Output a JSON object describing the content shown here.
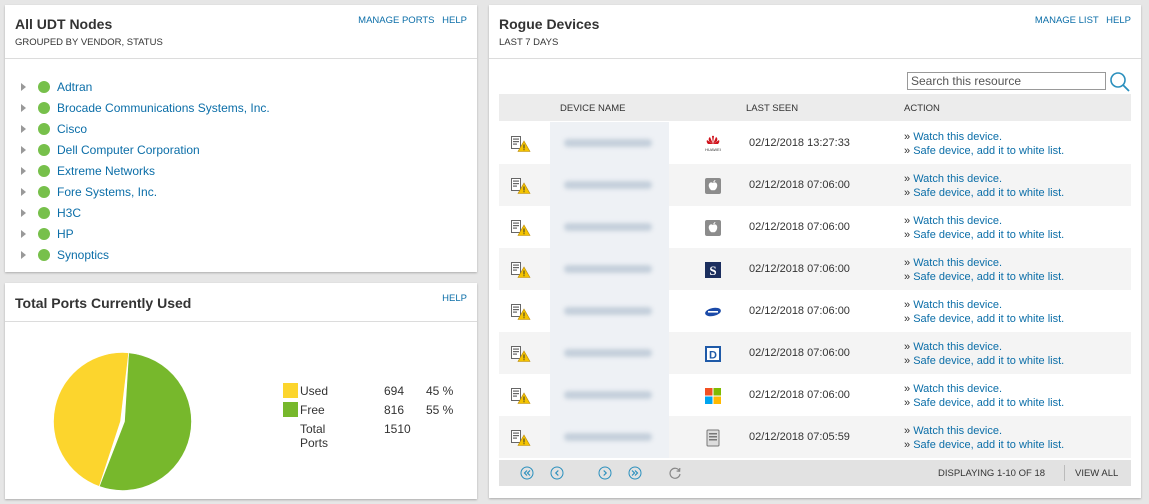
{
  "udt": {
    "title": "All UDT Nodes",
    "subtitle": "GROUPED BY VENDOR, STATUS",
    "links": {
      "manage": "MANAGE PORTS",
      "help": "HELP"
    },
    "vendors": [
      "Adtran",
      "Brocade Communications Systems, Inc.",
      "Cisco",
      "Dell Computer Corporation",
      "Extreme Networks",
      "Fore Systems, Inc.",
      "H3C",
      "HP",
      "Synoptics"
    ],
    "status_color": "#77c04b"
  },
  "ports": {
    "title": "Total Ports Currently Used",
    "links": {
      "help": "HELP"
    },
    "legend": [
      {
        "label": "Used",
        "value": "694",
        "pct": "45 %",
        "color": "#fcd52d"
      },
      {
        "label": "Free",
        "value": "816",
        "pct": "55 %",
        "color": "#77b82c"
      },
      {
        "label": "Total Ports",
        "value": "1510",
        "pct": ""
      }
    ]
  },
  "chart_data": {
    "type": "pie",
    "categories": [
      "Used",
      "Free"
    ],
    "values": [
      694,
      816
    ],
    "percent": [
      45,
      55
    ],
    "colors": [
      "#fcd52d",
      "#77b82c"
    ],
    "total": 1510,
    "legend_position": "right"
  },
  "rogue": {
    "title": "Rogue Devices",
    "subtitle": "LAST 7 DAYS",
    "links": {
      "manage": "MANAGE LIST",
      "help": "HELP"
    },
    "search": {
      "placeholder": "Search this resource"
    },
    "columns": {
      "name": "DEVICE NAME",
      "seen": "LAST SEEN",
      "action": "ACTION"
    },
    "action_prefix": "» ",
    "actions": {
      "watch": "Watch this device.",
      "safe": "Safe device, add it to white list."
    },
    "rows": [
      {
        "vendor_icon": "huawei-logo-icon",
        "last_seen": "02/12/2018 13:27:33"
      },
      {
        "vendor_icon": "apple-logo-icon",
        "last_seen": "02/12/2018 07:06:00"
      },
      {
        "vendor_icon": "apple-logo-icon",
        "last_seen": "02/12/2018 07:06:00"
      },
      {
        "vendor_icon": "s-logo-icon",
        "last_seen": "02/12/2018 07:06:00"
      },
      {
        "vendor_icon": "samsung-logo-icon",
        "last_seen": "02/12/2018 07:06:00"
      },
      {
        "vendor_icon": "d-logo-icon",
        "last_seen": "02/12/2018 07:06:00"
      },
      {
        "vendor_icon": "microsoft-logo-icon",
        "last_seen": "02/12/2018 07:06:00"
      },
      {
        "vendor_icon": "unknown-device-icon",
        "last_seen": "02/12/2018 07:05:59"
      }
    ],
    "pager": {
      "display": "DISPLAYING 1-10 OF 18",
      "view_all": "VIEW ALL"
    }
  }
}
